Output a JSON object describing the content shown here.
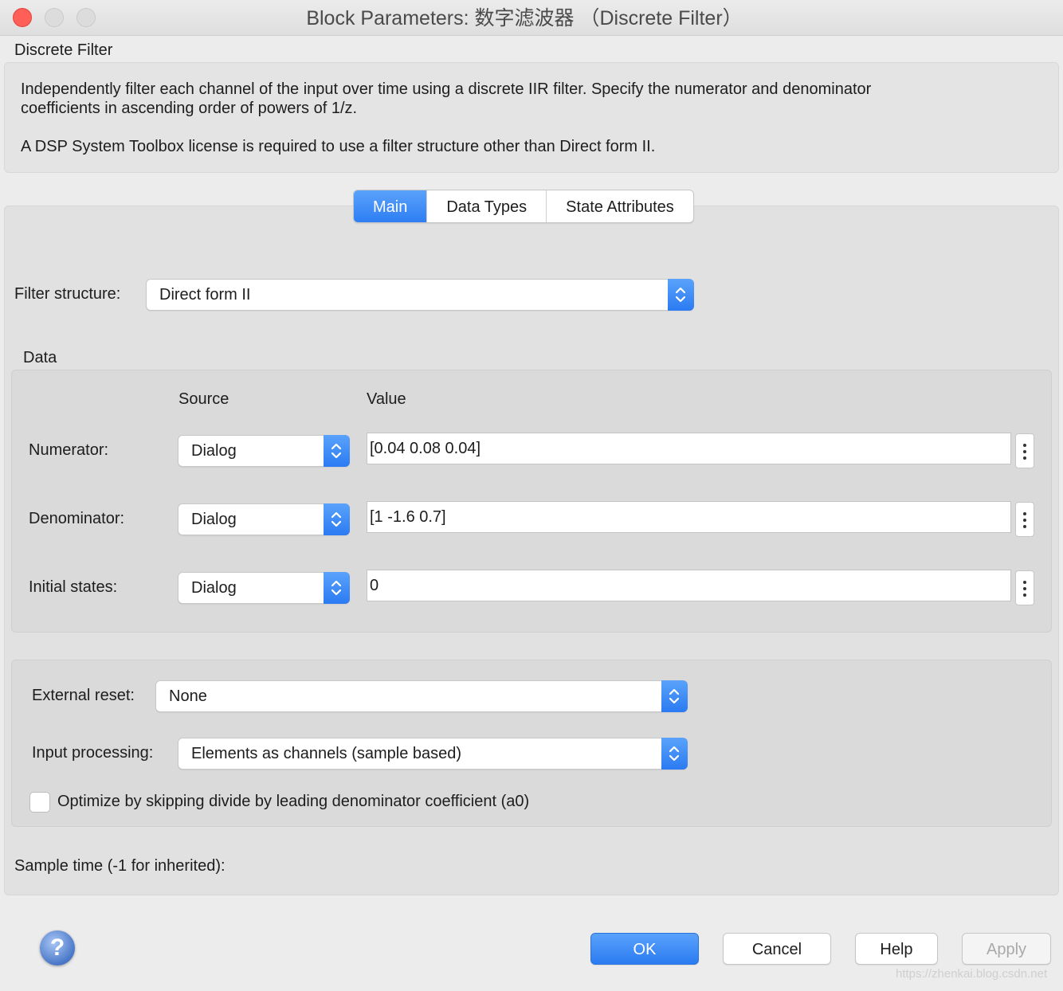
{
  "window": {
    "title": "Block Parameters: 数字滤波器 （Discrete Filter）"
  },
  "block": {
    "name": "Discrete Filter",
    "description_line1": "Independently filter each channel of the input over time using a discrete IIR filter. Specify the numerator and denominator",
    "description_line2": "coefficients in ascending order of powers of 1/z.",
    "description_line3": "A DSP System Toolbox license is required to use a filter structure other than Direct form II."
  },
  "tabs": [
    {
      "label": "Main",
      "active": true
    },
    {
      "label": "Data Types",
      "active": false
    },
    {
      "label": "State Attributes",
      "active": false
    }
  ],
  "filter_structure": {
    "label": "Filter structure:",
    "value": "Direct form II"
  },
  "data_section": {
    "title": "Data",
    "source_header": "Source",
    "value_header": "Value",
    "rows": [
      {
        "label": "Numerator:",
        "source": "Dialog",
        "value": "[0.04 0.08 0.04]"
      },
      {
        "label": "Denominator:",
        "source": "Dialog",
        "value": "[1 -1.6 0.7]"
      },
      {
        "label": "Initial states:",
        "source": "Dialog",
        "value": "0"
      }
    ]
  },
  "options": {
    "external_reset_label": "External reset:",
    "external_reset_value": "None",
    "input_processing_label": "Input processing:",
    "input_processing_value": "Elements as channels (sample based)",
    "optimize_label": "Optimize by skipping divide by leading denominator coefficient (a0)",
    "optimize_checked": false
  },
  "sample_time": {
    "label": "Sample time (-1 for inherited):"
  },
  "buttons": {
    "help_icon": "?",
    "ok": "OK",
    "cancel": "Cancel",
    "help": "Help",
    "apply": "Apply"
  },
  "watermark": "https://zhenkai.blog.csdn.net",
  "colors": {
    "accent": "#2e7ef4",
    "close": "#ff5f57"
  }
}
